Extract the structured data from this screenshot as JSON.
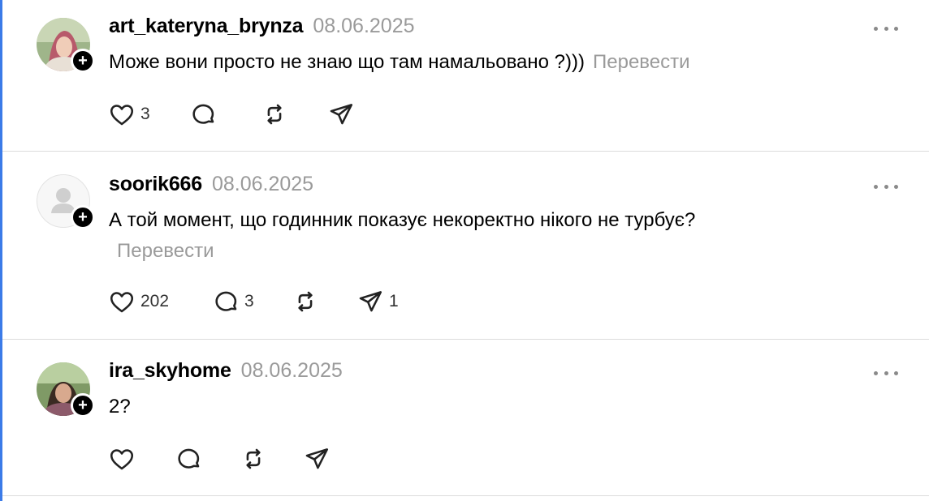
{
  "posts": [
    {
      "username": "art_kateryna_brynza",
      "date": "08.06.2025",
      "text": "Може вони просто не знаю що там намальовано ?)))",
      "translate_label": "Перевести",
      "likes": "3",
      "replies": "",
      "reposts": "",
      "shares": ""
    },
    {
      "username": "soorik666",
      "date": "08.06.2025",
      "text": "А той момент, що годинник показує некоректно нікого не турбує?",
      "translate_label": "Перевести",
      "likes": "202",
      "replies": "3",
      "reposts": "",
      "shares": "1"
    },
    {
      "username": "ira_skyhome",
      "date": "08.06.2025",
      "text": "2?",
      "translate_label": "",
      "likes": "",
      "replies": "",
      "reposts": "",
      "shares": ""
    }
  ],
  "icons": {
    "like": "heart-icon",
    "reply": "comment-bubble-icon",
    "repost": "repost-icon",
    "share": "send-icon",
    "more": "more-dots-icon",
    "follow": "plus-icon"
  },
  "colors": {
    "accent_left_rule": "#3b7be8",
    "muted_text": "#9a9a9a",
    "divider": "#dcdcdc"
  }
}
